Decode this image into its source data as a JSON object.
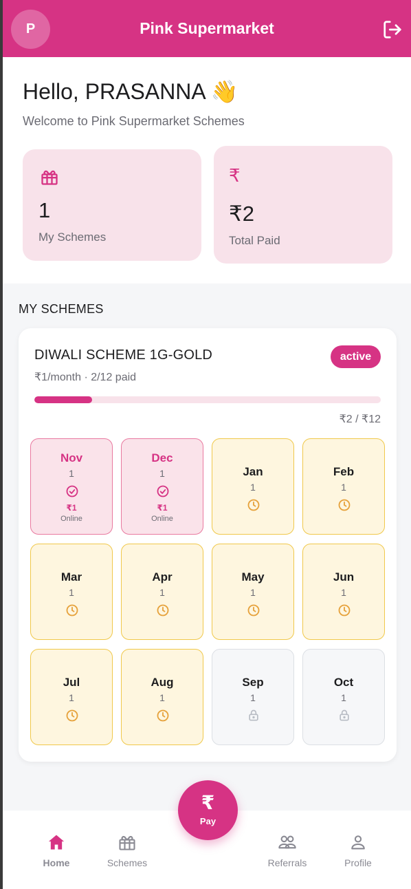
{
  "app": {
    "title": "Pink Supermarket",
    "avatar_initial": "P",
    "brand_color": "#d63384"
  },
  "greeting": {
    "hello": "Hello, PRASANNA 👋",
    "welcome": "Welcome to Pink Supermarket Schemes"
  },
  "stats": [
    {
      "icon": "gift-icon",
      "value": "1",
      "label": "My Schemes"
    },
    {
      "icon": "rupee-icon",
      "icon_glyph": "₹",
      "value": "₹2",
      "label": "Total Paid"
    }
  ],
  "section": {
    "title": "MY SCHEMES"
  },
  "scheme": {
    "name": "DIWALI SCHEME 1G-GOLD",
    "subtitle": "₹1/month · 2/12 paid",
    "status": "active",
    "progress_fraction": 0.1667,
    "amount_text": "₹2 / ₹12",
    "months": [
      {
        "name": "Nov",
        "count": "1",
        "status": "paid",
        "amount": "₹1",
        "mode": "Online"
      },
      {
        "name": "Dec",
        "count": "1",
        "status": "paid",
        "amount": "₹1",
        "mode": "Online"
      },
      {
        "name": "Jan",
        "count": "1",
        "status": "pending"
      },
      {
        "name": "Feb",
        "count": "1",
        "status": "pending"
      },
      {
        "name": "Mar",
        "count": "1",
        "status": "pending"
      },
      {
        "name": "Apr",
        "count": "1",
        "status": "pending"
      },
      {
        "name": "May",
        "count": "1",
        "status": "pending"
      },
      {
        "name": "Jun",
        "count": "1",
        "status": "pending"
      },
      {
        "name": "Jul",
        "count": "1",
        "status": "pending"
      },
      {
        "name": "Aug",
        "count": "1",
        "status": "pending"
      },
      {
        "name": "Sep",
        "count": "1",
        "status": "locked"
      },
      {
        "name": "Oct",
        "count": "1",
        "status": "locked"
      }
    ]
  },
  "nav": {
    "home": "Home",
    "schemes": "Schemes",
    "pay_glyph": "₹",
    "pay": "Pay",
    "referrals": "Referrals",
    "profile": "Profile"
  }
}
